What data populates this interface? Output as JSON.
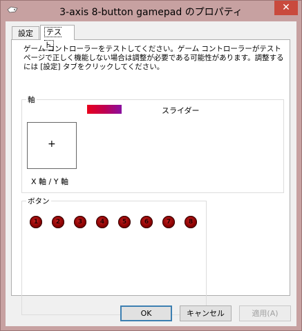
{
  "window": {
    "title": "3-axis 8-button gamepad のプロパティ",
    "close_glyph": "✕",
    "titlebar_color": "#c7a1a1",
    "close_color": "#c94a3d"
  },
  "tabs": [
    {
      "label": "設定",
      "active": false
    },
    {
      "label": "テスト",
      "active": true
    }
  ],
  "description": "ゲーム コントローラーをテストしてください。ゲーム コントローラーがテスト ページで正しく機能しない場合は調整が必要である可能性があります。調整するには [設定] タブをクリックしてください。",
  "axes": {
    "group_label": "軸",
    "slider_label": "スライダー",
    "xy_label": "X 軸 / Y 軸",
    "crosshair": "+"
  },
  "buttons": {
    "group_label": "ボタン",
    "items": [
      "1",
      "2",
      "3",
      "4",
      "5",
      "6",
      "7",
      "8"
    ]
  },
  "footer": {
    "ok": "OK",
    "cancel": "キャンセル",
    "apply": "適用(A)"
  }
}
